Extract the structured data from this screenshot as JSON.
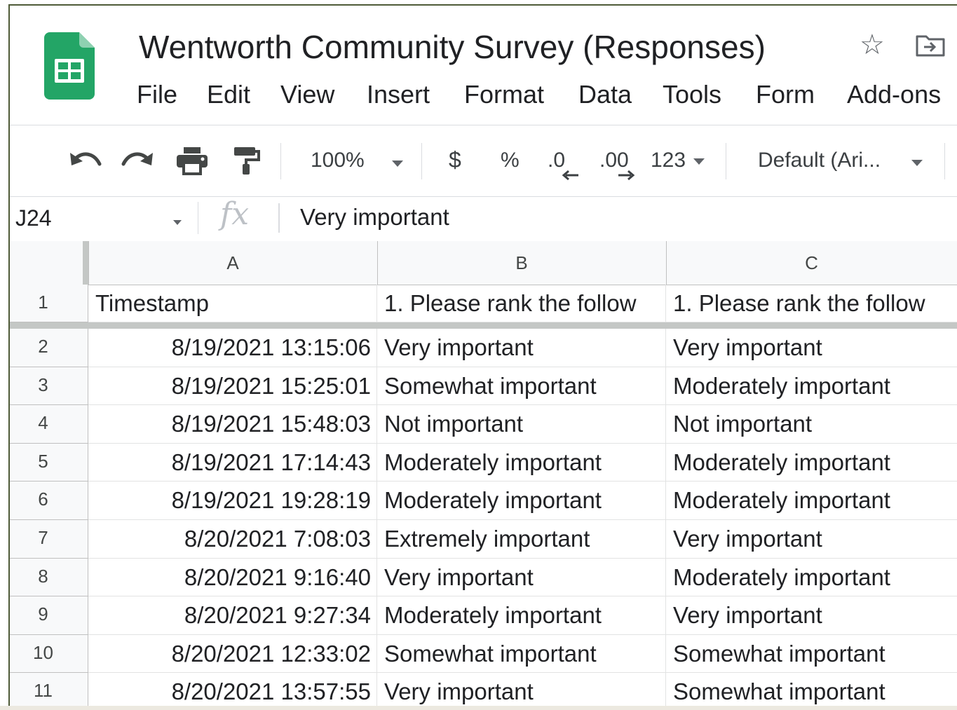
{
  "app": {
    "title": "Wentworth Community Survey (Responses)",
    "icons": {
      "logo": "sheets-logo-icon",
      "star": "star-icon",
      "move": "move-to-folder-icon"
    }
  },
  "menu": [
    "File",
    "Edit",
    "View",
    "Insert",
    "Format",
    "Data",
    "Tools",
    "Form",
    "Add-ons"
  ],
  "toolbar": {
    "icons": [
      "undo-icon",
      "redo-icon",
      "print-icon",
      "paint-format-icon"
    ],
    "zoom": "100%",
    "currency": "$",
    "percent": "%",
    "decrease_decimal": ".0",
    "increase_decimal": ".00",
    "more_formats": "123",
    "font": "Default (Ari..."
  },
  "formula_bar": {
    "cell_ref": "J24",
    "fx_label": "fx",
    "value": "Very important"
  },
  "grid": {
    "columns": [
      "A",
      "B",
      "C"
    ],
    "rows": [
      {
        "num": "1",
        "cells": [
          "Timestamp",
          "1.  Please rank the follow",
          "1.  Please rank the follow"
        ]
      },
      {
        "num": "2",
        "cells": [
          "8/19/2021 13:15:06",
          "Very important",
          "Very important"
        ]
      },
      {
        "num": "3",
        "cells": [
          "8/19/2021 15:25:01",
          "Somewhat important",
          "Moderately important"
        ]
      },
      {
        "num": "4",
        "cells": [
          "8/19/2021 15:48:03",
          "Not important",
          "Not important"
        ]
      },
      {
        "num": "5",
        "cells": [
          "8/19/2021 17:14:43",
          "Moderately important",
          "Moderately important"
        ]
      },
      {
        "num": "6",
        "cells": [
          "8/19/2021 19:28:19",
          "Moderately important",
          "Moderately important"
        ]
      },
      {
        "num": "7",
        "cells": [
          "8/20/2021 7:08:03",
          "Extremely important",
          "Very important"
        ]
      },
      {
        "num": "8",
        "cells": [
          "8/20/2021 9:16:40",
          "Very important",
          "Moderately important"
        ]
      },
      {
        "num": "9",
        "cells": [
          "8/20/2021 9:27:34",
          "Moderately important",
          "Very important"
        ]
      },
      {
        "num": "10",
        "cells": [
          "8/20/2021 12:33:02",
          "Somewhat important",
          "Somewhat important"
        ]
      },
      {
        "num": "11",
        "cells": [
          "8/20/2021 13:57:55",
          "Very important",
          "Somewhat important"
        ]
      }
    ]
  }
}
